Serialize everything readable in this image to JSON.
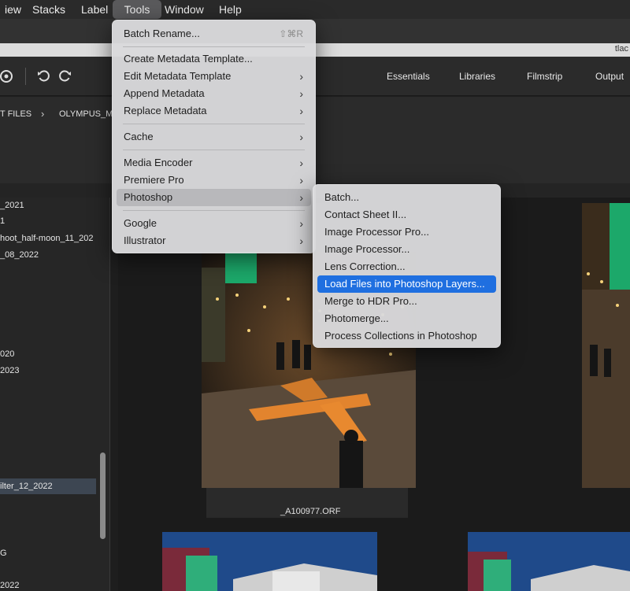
{
  "menubar": {
    "items": [
      "iew",
      "Stacks",
      "Label",
      "Tools",
      "Window",
      "Help"
    ]
  },
  "pathbar": {
    "text": "tlac"
  },
  "toolbar": {
    "workspaces": [
      "Essentials",
      "Libraries",
      "Filmstrip",
      "Output"
    ]
  },
  "breadcrumb": {
    "items": [
      "T FILES",
      "OLYMPUS_M"
    ]
  },
  "folders": [
    "_2021",
    "1",
    "hoot_half-moon_11_202",
    "_08_2022",
    "020",
    "2023",
    "ilter_12_2022",
    "G",
    "2022"
  ],
  "content": {
    "file_name": "_A100977.ORF"
  },
  "tools_menu": {
    "items": [
      {
        "label": "Batch Rename...",
        "shortcut": "⇧⌘R"
      },
      {
        "label": "Create Metadata Template..."
      },
      {
        "label": "Edit Metadata Template",
        "chevron": "›"
      },
      {
        "label": "Append Metadata",
        "chevron": "›"
      },
      {
        "label": "Replace Metadata",
        "chevron": "›"
      },
      {
        "label": "Cache",
        "chevron": "›"
      },
      {
        "label": "Media Encoder",
        "chevron": "›"
      },
      {
        "label": "Premiere Pro",
        "chevron": "›"
      },
      {
        "label": "Photoshop",
        "chevron": "›"
      },
      {
        "label": "Google",
        "chevron": "›"
      },
      {
        "label": "Illustrator",
        "chevron": "›"
      }
    ]
  },
  "photoshop_submenu": {
    "items": [
      "Batch...",
      "Contact Sheet II...",
      "Image Processor Pro...",
      "Image Processor...",
      "Lens Correction...",
      "Load Files into Photoshop Layers...",
      "Merge to HDR Pro...",
      "Photomerge...",
      "Process Collections in Photoshop"
    ]
  },
  "colors": {
    "highlight": "#1f6fe0",
    "menu_bg": "#dadadc",
    "app_bg": "#1e1e1e"
  }
}
